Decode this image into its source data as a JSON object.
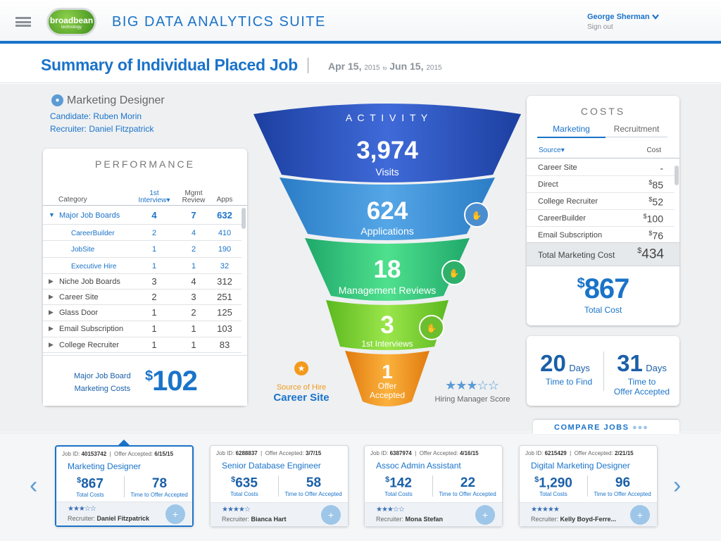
{
  "header": {
    "logo_main": "broadbean",
    "logo_sub": "technology",
    "app_title": "BIG DATA ANALYTICS SUITE",
    "user_name": "George Sherman",
    "sign_out": "Sign out"
  },
  "subheader": {
    "title": "Summary of Individual Placed Job",
    "date_from": "Apr 15,",
    "date_from_year": "2015",
    "date_to_word": "to",
    "date_to": "Jun 15,",
    "date_to_year": "2015"
  },
  "job": {
    "title": "Marketing Designer",
    "candidate": "Candidate: Ruben Morin",
    "recruiter": "Recruiter: Daniel Fitzpatrick"
  },
  "performance": {
    "heading": "PERFORMANCE",
    "col_category": "Category",
    "col_1st": "1st",
    "col_interview": "Interview",
    "col_mgmt": "Mgmt",
    "col_review": "Review",
    "col_apps": "Apps",
    "rows": [
      {
        "label": "Major Job Boards",
        "i": "4",
        "m": "7",
        "a": "632"
      },
      {
        "label": "CareerBuilder",
        "i": "2",
        "m": "4",
        "a": "410"
      },
      {
        "label": "JobSite",
        "i": "1",
        "m": "2",
        "a": "190"
      },
      {
        "label": "Executive Hire",
        "i": "1",
        "m": "1",
        "a": "32"
      },
      {
        "label": "Niche Job Boards",
        "i": "3",
        "m": "4",
        "a": "312"
      },
      {
        "label": "Career Site",
        "i": "2",
        "m": "3",
        "a": "251"
      },
      {
        "label": "Glass Door",
        "i": "1",
        "m": "2",
        "a": "125"
      },
      {
        "label": "Email Subscription",
        "i": "1",
        "m": "1",
        "a": "103"
      },
      {
        "label": "College Recruiter",
        "i": "1",
        "m": "1",
        "a": "83"
      }
    ],
    "summary_label_1": "Major Job Board",
    "summary_label_2": "Marketing Costs",
    "summary_currency": "$",
    "summary_value": "102"
  },
  "activity": {
    "heading": "A C T I V I T Y",
    "stages": [
      {
        "value": "3,974",
        "label": "Visits"
      },
      {
        "value": "624",
        "label": "Applications"
      },
      {
        "value": "18",
        "label": "Management Reviews"
      },
      {
        "value": "3",
        "label": "1st Interviews"
      },
      {
        "value": "1",
        "label": "Offer",
        "label2": "Accepted"
      }
    ],
    "source_label": "Source of Hire",
    "source_value": "Career Site",
    "score_stars": "★★★☆☆",
    "score_label": "Hiring Manager Score"
  },
  "costs": {
    "heading": "COSTS",
    "tab_marketing": "Marketing",
    "tab_recruitment": "Recruitment",
    "col_source": "Source",
    "col_cost": "Cost",
    "rows": [
      {
        "label": "Career Site",
        "cur": "",
        "val": "-"
      },
      {
        "label": "Direct",
        "cur": "$",
        "val": "85"
      },
      {
        "label": "College Recruiter",
        "cur": "$",
        "val": "52"
      },
      {
        "label": "CareerBuilder",
        "cur": "$",
        "val": "100"
      },
      {
        "label": "Email Subscription",
        "cur": "$",
        "val": "76"
      }
    ],
    "total_label": "Total Marketing Cost",
    "total_cur": "$",
    "total_value": "434",
    "grand_cur": "$",
    "grand_value": "867",
    "grand_label": "Total Cost"
  },
  "days": {
    "find_value": "20",
    "find_unit": "Days",
    "find_label": "Time to Find",
    "offer_value": "31",
    "offer_unit": "Days",
    "offer_label_1": "Time to",
    "offer_label_2": "Offer Accepted"
  },
  "compare": {
    "label": "COMPARE JOBS"
  },
  "jobs": [
    {
      "id_label": "Job ID:",
      "id": "40153742",
      "offer_label": "Offer Accepted:",
      "offer": "6/15/15",
      "title": "Marketing Designer",
      "cur": "$",
      "cost": "867",
      "cost_label": "Total Costs",
      "tto": "78",
      "tto_label": "Time to Offer Accepted",
      "stars": "★★★☆☆",
      "rec_label": "Recruiter:",
      "recruiter": "Daniel Fitzpatrick"
    },
    {
      "id_label": "Job ID:",
      "id": "6288837",
      "offer_label": "Offer Accepted:",
      "offer": "3/7/15",
      "title": "Senior Database Engineer",
      "cur": "$",
      "cost": "635",
      "cost_label": "Total Costs",
      "tto": "58",
      "tto_label": "Time to Offer Accepted",
      "stars": "★★★★☆",
      "rec_label": "Recruiter:",
      "recruiter": "Bianca Hart"
    },
    {
      "id_label": "Job ID:",
      "id": "6387974",
      "offer_label": "Offer Accepted:",
      "offer": "4/16/15",
      "title": "Assoc Admin Assistant",
      "cur": "$",
      "cost": "142",
      "cost_label": "Total Costs",
      "tto": "22",
      "tto_label": "Time to Offer Accepted",
      "stars": "★★★☆☆",
      "rec_label": "Recruiter:",
      "recruiter": "Mona Stefan"
    },
    {
      "id_label": "Job ID:",
      "id": "6215429",
      "offer_label": "Offer Accepted:",
      "offer": "2/21/15",
      "title": "Digital Marketing Designer",
      "cur": "$",
      "cost": "1,290",
      "cost_label": "Total Costs",
      "tto": "96",
      "tto_label": "Time to Offer Accepted",
      "stars": "★★★★★",
      "rec_label": "Recruiter:",
      "recruiter": "Kelly Boyd-Ferre..."
    }
  ],
  "colors": {
    "accent": "#1a73c9",
    "funnel_blue": "#2f5fc4",
    "funnel_green": "#43c46f",
    "funnel_orange": "#f39a1c"
  },
  "icons": {
    "menu": "hamburger-icon",
    "chevron": "chevron-down-icon",
    "user": "person-icon",
    "handshake": "handshake-icon",
    "badge": "award-icon",
    "people": "people-icon",
    "add_user": "add-user-icon",
    "prev": "chevron-left-icon",
    "next": "chevron-right-icon"
  }
}
